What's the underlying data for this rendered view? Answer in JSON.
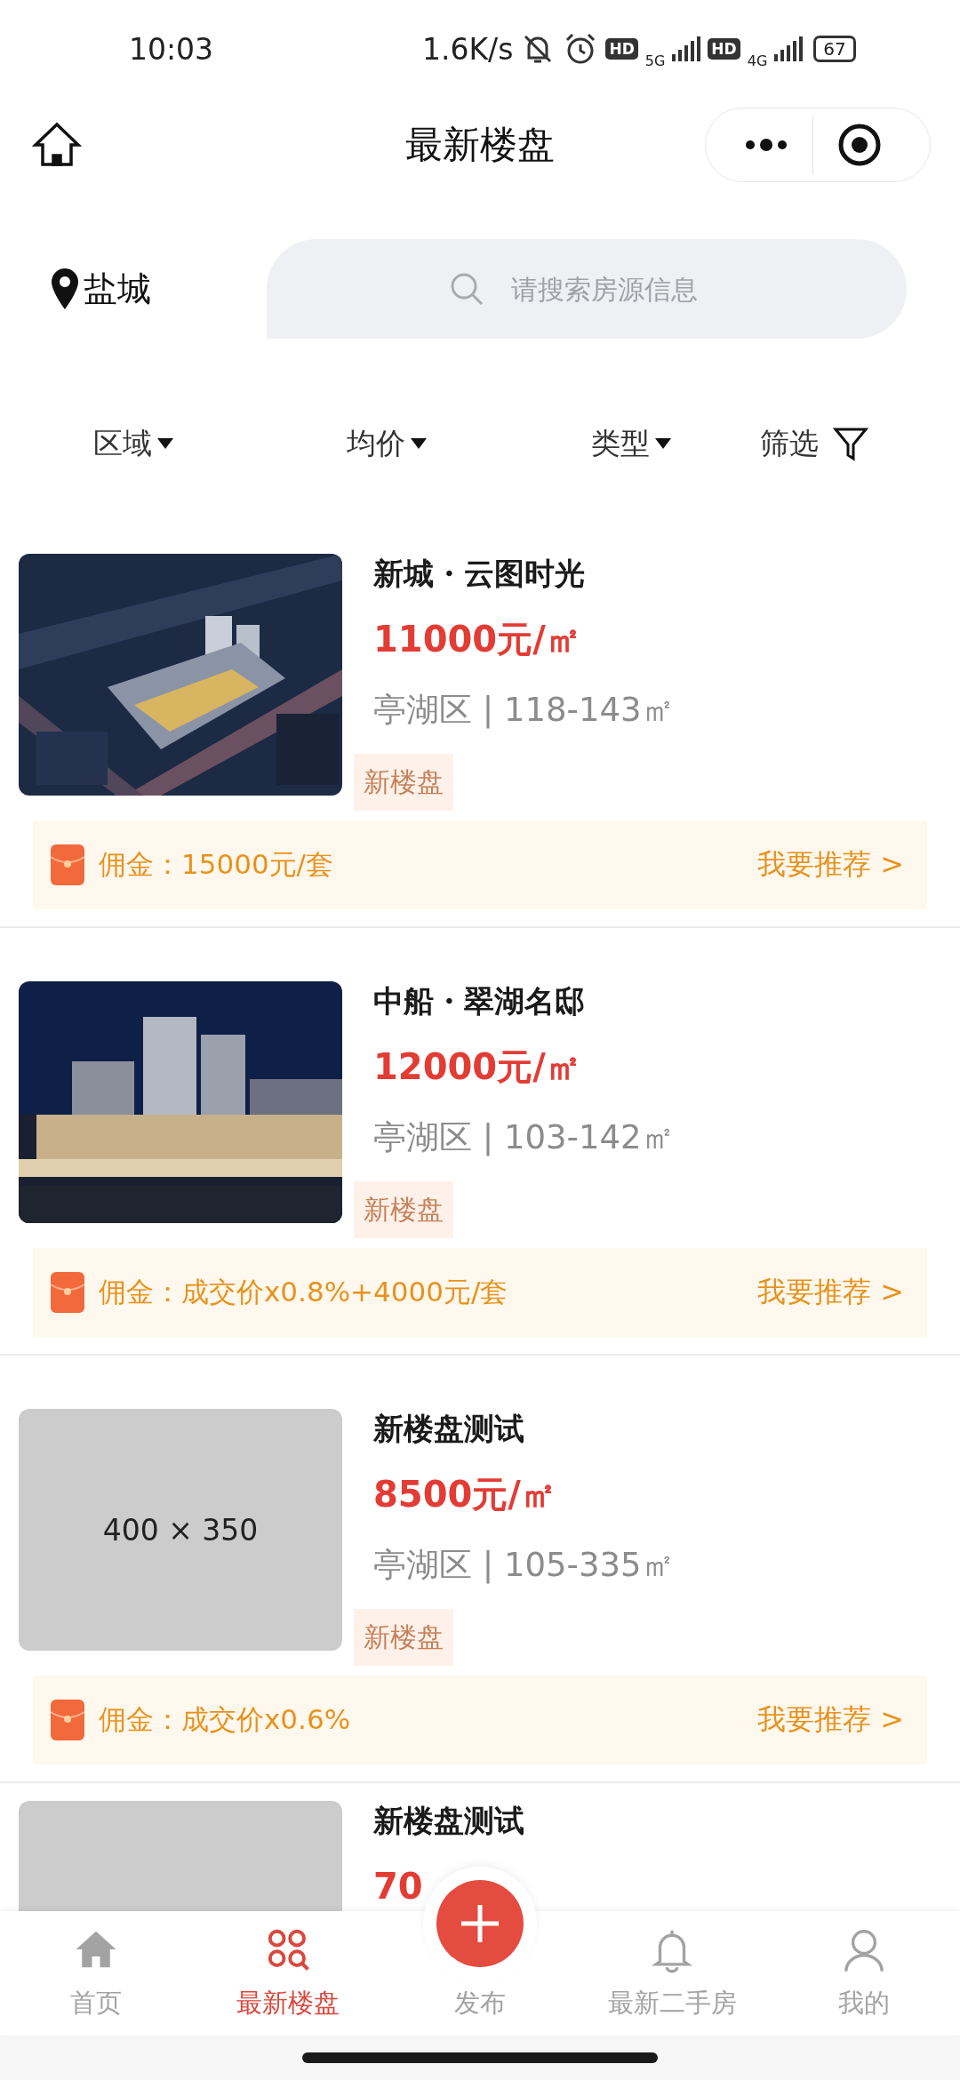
{
  "status_bar": {
    "time": "10:03",
    "network_speed": "1.6K/s",
    "signals": [
      {
        "hd": "HD",
        "network": "5G"
      },
      {
        "hd": "HD",
        "network": "4G"
      }
    ],
    "battery": "67"
  },
  "header": {
    "title": "最新楼盘"
  },
  "search": {
    "location": "盐城",
    "placeholder": "请搜索房源信息"
  },
  "filters": [
    {
      "label": "区域",
      "kind": "dropdown"
    },
    {
      "label": "均价",
      "kind": "dropdown"
    },
    {
      "label": "类型",
      "kind": "dropdown"
    },
    {
      "label": "筛选",
      "kind": "filter"
    }
  ],
  "listings": [
    {
      "title": "新城・云图时光",
      "price": "11000元/㎡",
      "location": "亭湖区 | 118-143㎡",
      "tag": "新楼盘",
      "commission": "佣金：15000元/套",
      "action": "我要推荐 >"
    },
    {
      "title": "中船・翠湖名邸",
      "price": "12000元/㎡",
      "location": "亭湖区 | 103-142㎡",
      "tag": "新楼盘",
      "commission": "佣金：成交价x0.8%+4000元/套",
      "action": "我要推荐 >"
    },
    {
      "title": "新楼盘测试",
      "price": "8500元/㎡",
      "location": "亭湖区 | 105-335㎡",
      "tag": "新楼盘",
      "commission": "佣金：成交价x0.6%",
      "action": "我要推荐 >",
      "image": {
        "kind": "placeholder",
        "text": "400 × 350"
      }
    },
    {
      "title": "新楼盘测试",
      "price": "70",
      "image": {
        "kind": "placeholder"
      }
    }
  ],
  "tab_bar": [
    {
      "label": "首页",
      "kind": "home",
      "selected": false
    },
    {
      "label": "最新楼盘",
      "kind": "circles",
      "selected": true
    },
    {
      "label": "发布",
      "kind": "plus",
      "selected": false
    },
    {
      "label": "最新二手房",
      "kind": "bell",
      "selected": false
    },
    {
      "label": "我的",
      "kind": "person",
      "selected": false
    }
  ]
}
